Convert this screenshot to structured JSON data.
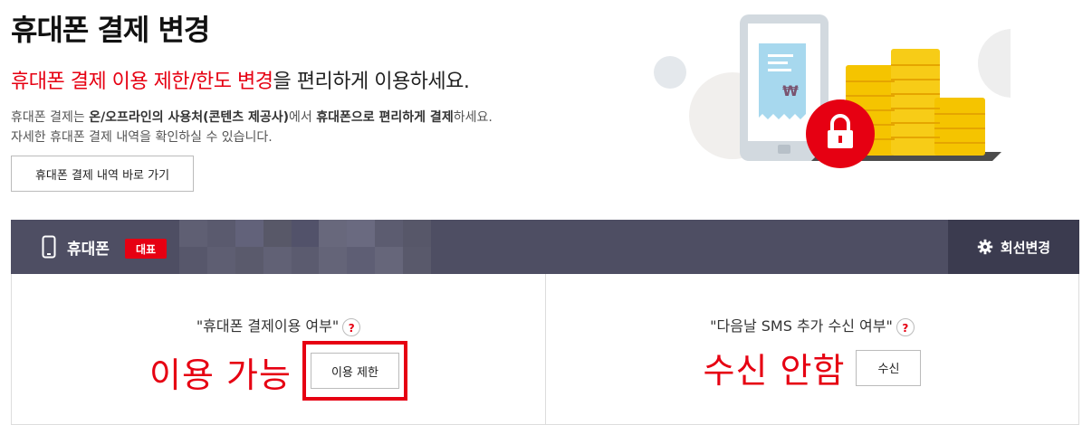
{
  "page": {
    "title": "휴대폰 결제 변경",
    "headline_highlight": "휴대폰 결제 이용 제한/한도 변경",
    "headline_rest": "을 편리하게 이용하세요.",
    "desc_line1": {
      "p1": "휴대폰 결제는 ",
      "b1": "온/오프라인의 사용처(콘텐츠 제공사)",
      "p2": "에서 ",
      "b2": "휴대폰으로 편리하게 결제",
      "p3": "하세요."
    },
    "desc_line2": "자세한 휴대폰 결제 내역을 확인하실 수 있습니다.",
    "history_button": "휴대폰 결제 내역 바로 가기"
  },
  "illustration": {
    "currency_symbol": "₩",
    "icons": [
      "phone-receipt-icon",
      "coin-stack-icon",
      "lock-icon"
    ],
    "accent": "#e60012",
    "coin": "#f5c400"
  },
  "phone_bar": {
    "label": "휴대폰",
    "badge": "대표",
    "number_masked": true,
    "line_change": "회선변경",
    "bg": "#4e4e63",
    "accent": "#e60012"
  },
  "panels": {
    "payment": {
      "question": "\"휴대폰 결제이용 여부\"",
      "help": "?",
      "status": "이용 가능",
      "button": "이용 제한"
    },
    "sms": {
      "question": "\"다음날 SMS 추가 수신 여부\"",
      "help": "?",
      "status": "수신 안함",
      "button": "수신"
    }
  }
}
